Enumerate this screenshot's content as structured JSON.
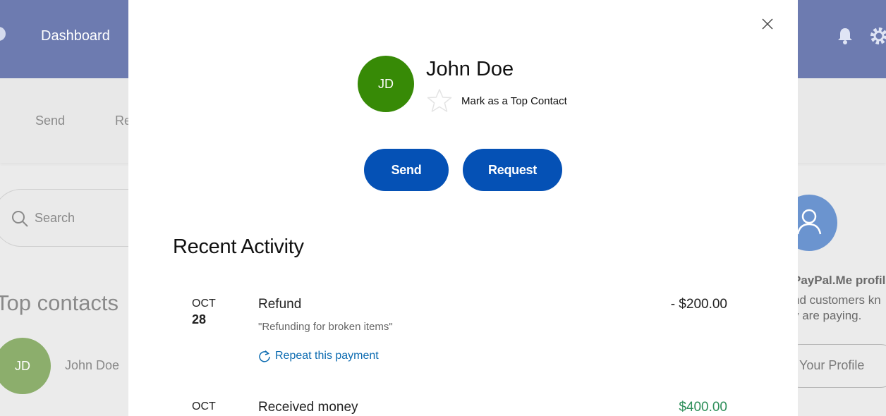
{
  "topbar": {
    "title": "Dashboard"
  },
  "subnav": {
    "items": [
      "Send",
      "Re"
    ]
  },
  "search": {
    "placeholder": "Search"
  },
  "top_contacts": {
    "title": "Top contacts",
    "contacts": [
      {
        "initials": "JD",
        "name": "John Doe"
      }
    ]
  },
  "paypal_me": {
    "title": "PayPal.Me profil",
    "line1": "nd customers kn",
    "line2": "y are paying.",
    "button": "Your Profile"
  },
  "modal": {
    "initials": "JD",
    "name": "John Doe",
    "top_contact_label": "Mark as a Top Contact",
    "send_label": "Send",
    "request_label": "Request",
    "recent_activity_title": "Recent Activity",
    "activities": [
      {
        "month": "OCT",
        "day": "28",
        "title": "Refund",
        "note": "\"Refunding for broken items\"",
        "amount": "- $200.00",
        "amount_color": "#222222",
        "action": "Repeat this payment"
      },
      {
        "month": "OCT",
        "title": "Received money",
        "amount": "$400.00",
        "amount_color": "#2e8f5a"
      }
    ]
  }
}
